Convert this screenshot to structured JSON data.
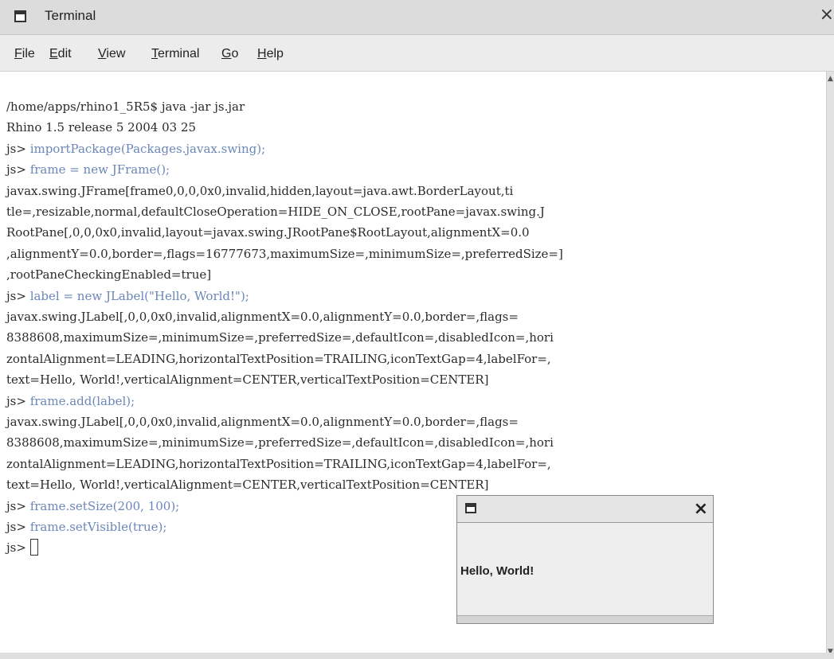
{
  "window": {
    "title": "Terminal",
    "close_glyph": "×"
  },
  "menu": {
    "items": [
      {
        "first": "F",
        "rest": "ile"
      },
      {
        "first": "E",
        "rest": "dit"
      },
      {
        "first": "V",
        "rest": "iew"
      },
      {
        "first": "T",
        "rest": "erminal"
      },
      {
        "first": "G",
        "rest": "o"
      },
      {
        "first": "H",
        "rest": "elp"
      }
    ]
  },
  "terminal": {
    "lines": [
      {
        "prompt": "",
        "cmd": "",
        "text": "/home/apps/rhino1_5R5$ java -jar js.jar"
      },
      {
        "prompt": "",
        "cmd": "",
        "text": "Rhino 1.5 release 5 2004 03 25"
      },
      {
        "prompt": "js> ",
        "cmd": "importPackage(Packages.javax.swing);",
        "text": ""
      },
      {
        "prompt": "js> ",
        "cmd": "frame = new JFrame();",
        "text": ""
      },
      {
        "prompt": "",
        "cmd": "",
        "text": "javax.swing.JFrame[frame0,0,0,0x0,invalid,hidden,layout=java.awt.BorderLayout,ti"
      },
      {
        "prompt": "",
        "cmd": "",
        "text": "tle=,resizable,normal,defaultCloseOperation=HIDE_ON_CLOSE,rootPane=javax.swing.J"
      },
      {
        "prompt": "",
        "cmd": "",
        "text": "RootPane[,0,0,0x0,invalid,layout=javax.swing.JRootPane$RootLayout,alignmentX=0.0"
      },
      {
        "prompt": "",
        "cmd": "",
        "text": ",alignmentY=0.0,border=,flags=16777673,maximumSize=,minimumSize=,preferredSize=]"
      },
      {
        "prompt": "",
        "cmd": "",
        "text": ",rootPaneCheckingEnabled=true]"
      },
      {
        "prompt": "js> ",
        "cmd": "label = new JLabel(\"Hello, World!\");",
        "text": ""
      },
      {
        "prompt": "",
        "cmd": "",
        "text": "javax.swing.JLabel[,0,0,0x0,invalid,alignmentX=0.0,alignmentY=0.0,border=,flags="
      },
      {
        "prompt": "",
        "cmd": "",
        "text": "8388608,maximumSize=,minimumSize=,preferredSize=,defaultIcon=,disabledIcon=,hori"
      },
      {
        "prompt": "",
        "cmd": "",
        "text": "zontalAlignment=LEADING,horizontalTextPosition=TRAILING,iconTextGap=4,labelFor=,"
      },
      {
        "prompt": "",
        "cmd": "",
        "text": "text=Hello, World!,verticalAlignment=CENTER,verticalTextPosition=CENTER]"
      },
      {
        "prompt": "js> ",
        "cmd": "frame.add(label);",
        "text": ""
      },
      {
        "prompt": "",
        "cmd": "",
        "text": "javax.swing.JLabel[,0,0,0x0,invalid,alignmentX=0.0,alignmentY=0.0,border=,flags="
      },
      {
        "prompt": "",
        "cmd": "",
        "text": "8388608,maximumSize=,minimumSize=,preferredSize=,defaultIcon=,disabledIcon=,hori"
      },
      {
        "prompt": "",
        "cmd": "",
        "text": "zontalAlignment=LEADING,horizontalTextPosition=TRAILING,iconTextGap=4,labelFor=,"
      },
      {
        "prompt": "",
        "cmd": "",
        "text": "text=Hello, World!,verticalAlignment=CENTER,verticalTextPosition=CENTER]"
      },
      {
        "prompt": "js> ",
        "cmd": "frame.setSize(200, 100);",
        "text": ""
      },
      {
        "prompt": "js> ",
        "cmd": "frame.setVisible(true);",
        "text": ""
      }
    ],
    "final_prompt": "js> "
  },
  "popup": {
    "close_glyph": "×",
    "label": "Hello, World!"
  },
  "colors": {
    "command_text": "#6b86b8",
    "output_text": "#2b2b2b"
  },
  "icons": [
    "window-menu-icon",
    "close-icon",
    "scroll-up-arrow-icon",
    "scroll-down-arrow-icon"
  ]
}
